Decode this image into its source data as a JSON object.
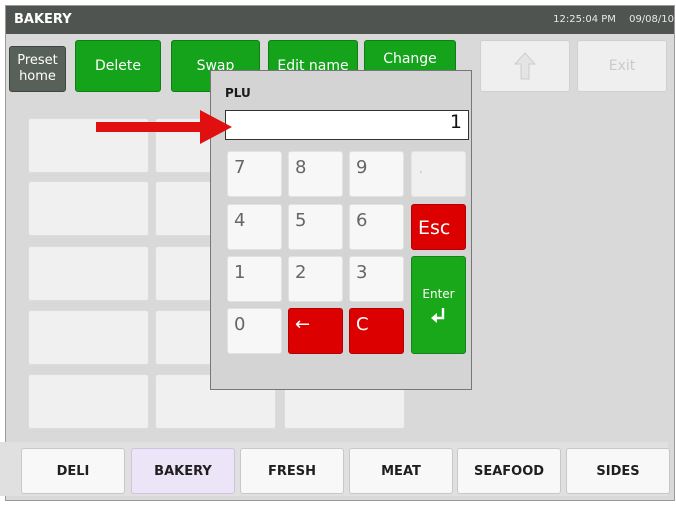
{
  "window": {
    "title": "BAKERY",
    "time": "12:25:04 PM",
    "date": "09/08/10"
  },
  "toolbar": {
    "preset_home": "Preset home",
    "delete": "Delete",
    "swap": "Swap",
    "edit_name": "Edit name",
    "change": "Change",
    "up_icon": "up-arrow-icon",
    "exit": "Exit"
  },
  "dialog": {
    "label": "PLU",
    "value": "1",
    "keys": {
      "k7": "7",
      "k8": "8",
      "k9": "9",
      "dot": ".",
      "k4": "4",
      "k5": "5",
      "k6": "6",
      "esc": "Esc",
      "k1": "1",
      "k2": "2",
      "k3": "3",
      "enter": "Enter",
      "k0": "0",
      "back": "←",
      "clear": "C"
    }
  },
  "categories": [
    {
      "label": "DELI",
      "active": false
    },
    {
      "label": "BAKERY",
      "active": true
    },
    {
      "label": "FRESH",
      "active": false
    },
    {
      "label": "MEAT",
      "active": false
    },
    {
      "label": "SEAFOOD",
      "active": false
    },
    {
      "label": "SIDES",
      "active": false
    }
  ],
  "colors": {
    "annotation_arrow": "#e01010",
    "accent_green": "#14a31a",
    "accent_red": "#dd0000"
  }
}
